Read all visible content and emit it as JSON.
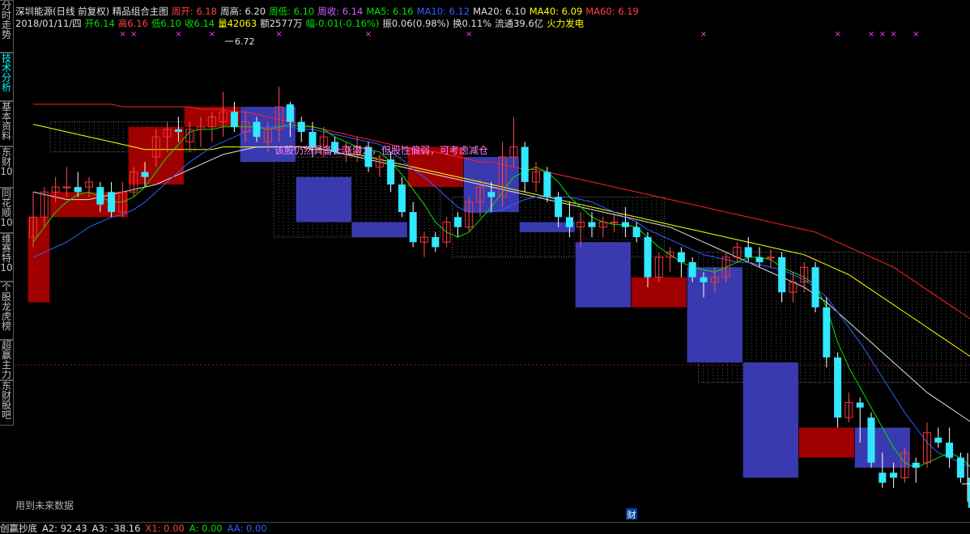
{
  "header": {
    "line1": [
      {
        "text": "深圳能源(日线 前复权) 精品组合主图",
        "color": "#e0e0e0"
      },
      {
        "text": "周开: 6.18",
        "color": "#ff4040"
      },
      {
        "text": "周高: 6.20",
        "color": "#e0e0e0"
      },
      {
        "text": "周低: 6.10",
        "color": "#00e000"
      },
      {
        "text": "周收: 6.14",
        "color": "#d060ff"
      },
      {
        "text": "MA5: 6.16",
        "color": "#00e000"
      },
      {
        "text": "MA10: 6.12",
        "color": "#3060ff"
      },
      {
        "text": "MA20: 6.10",
        "color": "#e0e0e0"
      },
      {
        "text": "MA40: 6.09",
        "color": "#ffff00"
      },
      {
        "text": "MA60: 6.19",
        "color": "#ff4040"
      }
    ],
    "line2": [
      {
        "text": "2018/01/11/四",
        "color": "#e0e0e0"
      },
      {
        "text": "开6.14",
        "color": "#00e000"
      },
      {
        "text": "高6.16",
        "color": "#ff4040"
      },
      {
        "text": "低6.10",
        "color": "#00e000"
      },
      {
        "text": "收6.14",
        "color": "#00e000"
      },
      {
        "text": "量42063",
        "color": "#ffff00"
      },
      {
        "text": "额2577万",
        "color": "#e0e0e0"
      },
      {
        "text": "幅-0.01(-0.16%)",
        "color": "#00e000"
      },
      {
        "text": "振0.06(0.98%)",
        "color": "#e0e0e0"
      },
      {
        "text": "换0.11%",
        "color": "#e0e0e0"
      },
      {
        "text": "流通39.6亿",
        "color": "#e0e0e0"
      },
      {
        "text": "火力发电",
        "color": "#ffff00"
      }
    ]
  },
  "sidebar": {
    "tabs": [
      {
        "label": "分时走势",
        "active": false
      },
      {
        "label": "技术分析",
        "active": true
      },
      {
        "label": "基本资料",
        "active": false
      },
      {
        "label": "东财10",
        "active": false
      },
      {
        "label": "同花顺10",
        "active": false
      },
      {
        "label": "维赛特10",
        "active": false
      },
      {
        "label": "个股龙虎榜",
        "active": false
      },
      {
        "label": "超赢主力",
        "active": false
      },
      {
        "label": "东财股吧",
        "active": false
      }
    ]
  },
  "annotations": {
    "high_label": "6.72",
    "note": "该股仍然具备上涨潜力，但股性偏弱，可考虑减仓",
    "future_data": "用到未来数据",
    "finance_marker": "财"
  },
  "footer": {
    "items": [
      {
        "text": "创赢抄底",
        "color": "#e0e0e0"
      },
      {
        "text": "A2: 92.43",
        "color": "#e0e0e0"
      },
      {
        "text": "A3: -38.16",
        "color": "#e0e0e0"
      },
      {
        "text": "X1: 0.00",
        "color": "#ff4040"
      },
      {
        "text": "A: 0.00",
        "color": "#00e000"
      },
      {
        "text": "AA: 0.00",
        "color": "#3060ff"
      }
    ]
  },
  "chart_data": {
    "type": "candlestick",
    "title": "深圳能源(日线 前复权) 精品组合主图",
    "colors": {
      "up": "#ff3030",
      "down": "#30e8ff",
      "ma5": "#00e000",
      "ma10": "#3060ff",
      "ma20": "#e0e0e0",
      "ma40": "#ffff00",
      "ma60": "#ff2020",
      "box_up": "#a00000",
      "box_down": "#3a3ab0"
    },
    "ylim": [
      5.0,
      6.95
    ],
    "candles": [
      {
        "o": 6.12,
        "h": 6.3,
        "l": 6.08,
        "c": 6.2
      },
      {
        "o": 6.2,
        "h": 6.32,
        "l": 6.16,
        "c": 6.3
      },
      {
        "o": 6.3,
        "h": 6.36,
        "l": 6.26,
        "c": 6.32
      },
      {
        "o": 6.32,
        "h": 6.4,
        "l": 6.28,
        "c": 6.32
      },
      {
        "o": 6.32,
        "h": 6.38,
        "l": 6.28,
        "c": 6.3
      },
      {
        "o": 6.32,
        "h": 6.36,
        "l": 6.28,
        "c": 6.34
      },
      {
        "o": 6.32,
        "h": 6.34,
        "l": 6.22,
        "c": 6.25
      },
      {
        "o": 6.3,
        "h": 6.34,
        "l": 6.2,
        "c": 6.22
      },
      {
        "o": 6.22,
        "h": 6.34,
        "l": 6.2,
        "c": 6.3
      },
      {
        "o": 6.3,
        "h": 6.4,
        "l": 6.28,
        "c": 6.38
      },
      {
        "o": 6.38,
        "h": 6.42,
        "l": 6.32,
        "c": 6.36
      },
      {
        "o": 6.44,
        "h": 6.55,
        "l": 6.4,
        "c": 6.52
      },
      {
        "o": 6.52,
        "h": 6.58,
        "l": 6.46,
        "c": 6.55
      },
      {
        "o": 6.55,
        "h": 6.6,
        "l": 6.5,
        "c": 6.54
      },
      {
        "o": 6.5,
        "h": 6.58,
        "l": 6.46,
        "c": 6.55
      },
      {
        "o": 6.55,
        "h": 6.6,
        "l": 6.48,
        "c": 6.56
      },
      {
        "o": 6.56,
        "h": 6.62,
        "l": 6.5,
        "c": 6.6
      },
      {
        "o": 6.58,
        "h": 6.7,
        "l": 6.52,
        "c": 6.62
      },
      {
        "o": 6.62,
        "h": 6.66,
        "l": 6.54,
        "c": 6.56
      },
      {
        "o": 6.54,
        "h": 6.62,
        "l": 6.5,
        "c": 6.58
      },
      {
        "o": 6.58,
        "h": 6.6,
        "l": 6.5,
        "c": 6.52
      },
      {
        "o": 6.5,
        "h": 6.58,
        "l": 6.46,
        "c": 6.55
      },
      {
        "o": 6.55,
        "h": 6.72,
        "l": 6.5,
        "c": 6.64
      },
      {
        "o": 6.65,
        "h": 6.66,
        "l": 6.52,
        "c": 6.58
      },
      {
        "o": 6.58,
        "h": 6.6,
        "l": 6.5,
        "c": 6.54
      },
      {
        "o": 6.54,
        "h": 6.58,
        "l": 6.44,
        "c": 6.48
      },
      {
        "o": 6.48,
        "h": 6.56,
        "l": 6.44,
        "c": 6.52
      },
      {
        "o": 6.5,
        "h": 6.52,
        "l": 6.45,
        "c": 6.46
      },
      {
        "o": 6.46,
        "h": 6.5,
        "l": 6.42,
        "c": 6.48
      },
      {
        "o": 6.46,
        "h": 6.52,
        "l": 6.42,
        "c": 6.48
      },
      {
        "o": 6.48,
        "h": 6.5,
        "l": 6.38,
        "c": 6.4
      },
      {
        "o": 6.4,
        "h": 6.45,
        "l": 6.36,
        "c": 6.43
      },
      {
        "o": 6.43,
        "h": 6.46,
        "l": 6.3,
        "c": 6.33
      },
      {
        "o": 6.33,
        "h": 6.36,
        "l": 6.2,
        "c": 6.22
      },
      {
        "o": 6.22,
        "h": 6.26,
        "l": 6.08,
        "c": 6.1
      },
      {
        "o": 6.1,
        "h": 6.14,
        "l": 6.04,
        "c": 6.12
      },
      {
        "o": 6.12,
        "h": 6.14,
        "l": 6.06,
        "c": 6.08
      },
      {
        "o": 6.1,
        "h": 6.2,
        "l": 6.08,
        "c": 6.18
      },
      {
        "o": 6.2,
        "h": 6.22,
        "l": 6.12,
        "c": 6.16
      },
      {
        "o": 6.16,
        "h": 6.28,
        "l": 6.14,
        "c": 6.26
      },
      {
        "o": 6.26,
        "h": 6.35,
        "l": 6.2,
        "c": 6.32
      },
      {
        "o": 6.3,
        "h": 6.34,
        "l": 6.22,
        "c": 6.28
      },
      {
        "o": 6.28,
        "h": 6.5,
        "l": 6.24,
        "c": 6.44
      },
      {
        "o": 6.44,
        "h": 6.6,
        "l": 6.4,
        "c": 6.48
      },
      {
        "o": 6.48,
        "h": 6.5,
        "l": 6.3,
        "c": 6.34
      },
      {
        "o": 6.34,
        "h": 6.42,
        "l": 6.3,
        "c": 6.38
      },
      {
        "o": 6.38,
        "h": 6.4,
        "l": 6.26,
        "c": 6.28
      },
      {
        "o": 6.28,
        "h": 6.3,
        "l": 6.16,
        "c": 6.2
      },
      {
        "o": 6.2,
        "h": 6.26,
        "l": 6.12,
        "c": 6.16
      },
      {
        "o": 6.16,
        "h": 6.22,
        "l": 6.08,
        "c": 6.18
      },
      {
        "o": 6.18,
        "h": 6.22,
        "l": 6.12,
        "c": 6.16
      },
      {
        "o": 6.16,
        "h": 6.2,
        "l": 6.12,
        "c": 6.18
      },
      {
        "o": 6.18,
        "h": 6.22,
        "l": 6.14,
        "c": 6.18
      },
      {
        "o": 6.18,
        "h": 6.24,
        "l": 6.12,
        "c": 6.16
      },
      {
        "o": 6.16,
        "h": 6.18,
        "l": 6.1,
        "c": 6.12
      },
      {
        "o": 6.12,
        "h": 6.14,
        "l": 5.92,
        "c": 5.96
      },
      {
        "o": 5.96,
        "h": 6.06,
        "l": 5.94,
        "c": 6.04
      },
      {
        "o": 6.04,
        "h": 6.08,
        "l": 5.98,
        "c": 6.06
      },
      {
        "o": 6.06,
        "h": 6.08,
        "l": 5.96,
        "c": 6.02
      },
      {
        "o": 6.02,
        "h": 6.04,
        "l": 5.94,
        "c": 5.96
      },
      {
        "o": 5.96,
        "h": 5.98,
        "l": 5.88,
        "c": 5.94
      },
      {
        "o": 5.94,
        "h": 6.0,
        "l": 5.9,
        "c": 5.96
      },
      {
        "o": 5.96,
        "h": 6.06,
        "l": 5.94,
        "c": 6.04
      },
      {
        "o": 6.04,
        "h": 6.1,
        "l": 6.02,
        "c": 6.08
      },
      {
        "o": 6.08,
        "h": 6.12,
        "l": 6.02,
        "c": 6.04
      },
      {
        "o": 6.04,
        "h": 6.08,
        "l": 6.0,
        "c": 6.02
      },
      {
        "o": 6.04,
        "h": 6.07,
        "l": 6.0,
        "c": 6.04
      },
      {
        "o": 6.04,
        "h": 6.06,
        "l": 5.86,
        "c": 5.9
      },
      {
        "o": 5.9,
        "h": 5.98,
        "l": 5.86,
        "c": 5.94
      },
      {
        "o": 5.94,
        "h": 6.02,
        "l": 5.9,
        "c": 6.0
      },
      {
        "o": 6.0,
        "h": 6.02,
        "l": 5.82,
        "c": 5.84
      },
      {
        "o": 5.84,
        "h": 5.88,
        "l": 5.6,
        "c": 5.64
      },
      {
        "o": 5.64,
        "h": 5.66,
        "l": 5.36,
        "c": 5.4
      },
      {
        "o": 5.4,
        "h": 5.5,
        "l": 5.38,
        "c": 5.46
      },
      {
        "o": 5.46,
        "h": 5.48,
        "l": 5.3,
        "c": 5.44
      },
      {
        "o": 5.4,
        "h": 5.42,
        "l": 5.2,
        "c": 5.22
      },
      {
        "o": 5.18,
        "h": 5.26,
        "l": 5.12,
        "c": 5.14
      },
      {
        "o": 5.18,
        "h": 5.22,
        "l": 5.12,
        "c": 5.16
      },
      {
        "o": 5.16,
        "h": 5.28,
        "l": 5.14,
        "c": 5.26
      },
      {
        "o": 5.22,
        "h": 5.24,
        "l": 5.14,
        "c": 5.2
      },
      {
        "o": 5.22,
        "h": 5.38,
        "l": 5.2,
        "c": 5.34
      },
      {
        "o": 5.32,
        "h": 5.36,
        "l": 5.28,
        "c": 5.3
      },
      {
        "o": 5.3,
        "h": 5.36,
        "l": 5.2,
        "c": 5.24
      },
      {
        "o": 5.24,
        "h": 5.26,
        "l": 5.14,
        "c": 5.16
      },
      {
        "o": 5.16,
        "h": 5.18,
        "l": 5.02,
        "c": 5.04
      },
      {
        "o": 5.06,
        "h": 5.18,
        "l": 4.98,
        "c": 5.04
      }
    ],
    "ma": {
      "ma5": [
        6.1,
        6.16,
        6.22,
        6.26,
        6.29,
        6.3,
        6.28,
        6.26,
        6.26,
        6.28,
        6.32,
        6.38,
        6.44,
        6.49,
        6.54,
        6.55,
        6.55,
        6.56,
        6.56,
        6.56,
        6.56,
        6.55,
        6.56,
        6.57,
        6.56,
        6.56,
        6.55,
        6.52,
        6.5,
        6.48,
        6.47,
        6.46,
        6.42,
        6.37,
        6.31,
        6.25,
        6.18,
        6.14,
        6.12,
        6.14,
        6.19,
        6.24,
        6.3,
        6.36,
        6.38,
        6.4,
        6.38,
        6.34,
        6.28,
        6.24,
        6.2,
        6.18,
        6.17,
        6.17,
        6.16,
        6.12,
        6.08,
        6.05,
        6.02,
        6.0,
        5.99,
        5.98,
        6.0,
        6.02,
        6.04,
        6.04,
        6.03,
        6.0,
        5.98,
        5.96,
        5.93,
        5.84,
        5.7,
        5.6,
        5.52,
        5.44,
        5.36,
        5.28,
        5.22,
        5.2,
        5.22,
        5.24,
        5.26,
        5.24,
        5.2,
        5.16
      ],
      "ma10": [
        6.04,
        6.06,
        6.08,
        6.1,
        6.13,
        6.16,
        6.18,
        6.2,
        6.21,
        6.23,
        6.26,
        6.3,
        6.34,
        6.38,
        6.42,
        6.45,
        6.48,
        6.5,
        6.52,
        6.54,
        6.55,
        6.56,
        6.56,
        6.56,
        6.55,
        6.55,
        6.54,
        6.53,
        6.52,
        6.51,
        6.5,
        6.49,
        6.46,
        6.43,
        6.39,
        6.36,
        6.32,
        6.28,
        6.24,
        6.22,
        6.22,
        6.22,
        6.23,
        6.25,
        6.27,
        6.28,
        6.28,
        6.28,
        6.28,
        6.27,
        6.26,
        6.24,
        6.22,
        6.2,
        6.18,
        6.15,
        6.13,
        6.11,
        6.09,
        6.07,
        6.05,
        6.04,
        6.03,
        6.02,
        6.02,
        6.01,
        6.0,
        5.99,
        5.97,
        5.95,
        5.92,
        5.88,
        5.82,
        5.76,
        5.7,
        5.63,
        5.56,
        5.49,
        5.42,
        5.36,
        5.3,
        5.26,
        5.24,
        5.22,
        5.2,
        5.18
      ],
      "ma20": [
        6.3,
        6.29,
        6.28,
        6.27,
        6.27,
        6.27,
        6.28,
        6.29,
        6.3,
        6.31,
        6.32,
        6.33,
        6.35,
        6.37,
        6.39,
        6.41,
        6.43,
        6.45,
        6.46,
        6.47,
        6.48,
        6.48,
        6.48,
        6.48,
        6.48,
        6.48,
        6.47,
        6.46,
        6.45,
        6.44,
        6.43,
        6.42,
        6.41,
        6.4,
        6.39,
        6.38,
        6.37,
        6.36,
        6.35,
        6.34,
        6.33,
        6.32,
        6.31,
        6.3,
        6.29,
        6.28,
        6.27,
        6.26,
        6.25,
        6.24,
        6.23,
        6.22,
        6.21,
        6.2,
        6.19,
        6.18,
        6.17,
        6.16,
        6.14,
        6.12,
        6.1,
        6.08,
        6.06,
        6.04,
        6.02,
        6.0,
        5.98,
        5.96,
        5.94,
        5.92,
        5.89,
        5.86,
        5.82,
        5.78,
        5.74,
        5.7,
        5.66,
        5.62,
        5.58,
        5.54,
        5.5,
        5.47,
        5.44,
        5.41,
        5.38,
        5.35
      ],
      "ma40": [
        6.57,
        6.56,
        6.55,
        6.54,
        6.53,
        6.52,
        6.51,
        6.5,
        6.49,
        6.48,
        6.47,
        6.47,
        6.47,
        6.47,
        6.47,
        6.47,
        6.47,
        6.48,
        6.48,
        6.48,
        6.48,
        6.48,
        6.48,
        6.48,
        6.48,
        6.47,
        6.47,
        6.46,
        6.45,
        6.45,
        6.44,
        6.43,
        6.42,
        6.41,
        6.4,
        6.39,
        6.38,
        6.37,
        6.36,
        6.35,
        6.34,
        6.33,
        6.32,
        6.31,
        6.3,
        6.29,
        6.28,
        6.27,
        6.26,
        6.25,
        6.24,
        6.23,
        6.22,
        6.21,
        6.2,
        6.19,
        6.18,
        6.17,
        6.16,
        6.15,
        6.14,
        6.13,
        6.12,
        6.11,
        6.1,
        6.09,
        6.08,
        6.07,
        6.06,
        6.05,
        6.03,
        6.01,
        5.99,
        5.97,
        5.94,
        5.91,
        5.88,
        5.85,
        5.82,
        5.79,
        5.76,
        5.73,
        5.7,
        5.67,
        5.64,
        5.61
      ],
      "ma60": [
        6.65,
        6.65,
        6.65,
        6.65,
        6.65,
        6.65,
        6.65,
        6.65,
        6.64,
        6.64,
        6.64,
        6.64,
        6.64,
        6.64,
        6.64,
        6.63,
        6.63,
        6.63,
        6.62,
        6.62,
        6.61,
        6.6,
        6.59,
        6.58,
        6.57,
        6.56,
        6.55,
        6.54,
        6.53,
        6.52,
        6.51,
        6.5,
        6.49,
        6.48,
        6.47,
        6.46,
        6.46,
        6.45,
        6.44,
        6.43,
        6.42,
        6.42,
        6.41,
        6.4,
        6.39,
        6.39,
        6.38,
        6.37,
        6.36,
        6.35,
        6.34,
        6.33,
        6.32,
        6.31,
        6.3,
        6.29,
        6.28,
        6.27,
        6.26,
        6.25,
        6.24,
        6.23,
        6.22,
        6.21,
        6.2,
        6.19,
        6.18,
        6.17,
        6.16,
        6.15,
        6.14,
        6.12,
        6.1,
        6.08,
        6.06,
        6.04,
        6.02,
        6.0,
        5.97,
        5.94,
        5.91,
        5.88,
        5.85,
        5.82,
        5.79,
        5.76
      ]
    },
    "weekly_boxes": [
      {
        "start": 0,
        "end": 1,
        "o": 5.86,
        "c": 6.2,
        "dir": "up"
      },
      {
        "start": 2,
        "end": 8,
        "o": 6.2,
        "c": 6.3,
        "dir": "up"
      },
      {
        "start": 9,
        "end": 13,
        "o": 6.33,
        "c": 6.56,
        "dir": "up"
      },
      {
        "start": 14,
        "end": 18,
        "o": 6.56,
        "c": 6.64,
        "dir": "up"
      },
      {
        "start": 19,
        "end": 23,
        "o": 6.64,
        "c": 6.42,
        "dir": "down"
      },
      {
        "start": 24,
        "end": 28,
        "o": 6.36,
        "c": 6.18,
        "dir": "down"
      },
      {
        "start": 29,
        "end": 33,
        "o": 6.18,
        "c": 6.12,
        "dir": "down"
      },
      {
        "start": 34,
        "end": 38,
        "o": 6.32,
        "c": 6.48,
        "dir": "up"
      },
      {
        "start": 39,
        "end": 43,
        "o": 6.44,
        "c": 6.22,
        "dir": "down"
      },
      {
        "start": 44,
        "end": 48,
        "o": 6.18,
        "c": 6.14,
        "dir": "down"
      },
      {
        "start": 49,
        "end": 53,
        "o": 6.1,
        "c": 5.84,
        "dir": "down"
      },
      {
        "start": 54,
        "end": 58,
        "o": 5.84,
        "c": 5.96,
        "dir": "up"
      },
      {
        "start": 59,
        "end": 63,
        "o": 6.0,
        "c": 5.62,
        "dir": "down"
      },
      {
        "start": 64,
        "end": 68,
        "o": 5.62,
        "c": 5.16,
        "dir": "down"
      },
      {
        "start": 69,
        "end": 73,
        "o": 5.36,
        "c": 5.24,
        "dir": "up"
      },
      {
        "start": 74,
        "end": 78,
        "o": 5.36,
        "c": 5.2,
        "dir": "down"
      }
    ],
    "dotted_boxes": [
      {
        "start": 2,
        "end": 14,
        "top": 6.58,
        "bottom": 6.46
      },
      {
        "start": 22,
        "end": 36,
        "top": 6.44,
        "bottom": 6.12
      },
      {
        "start": 38,
        "end": 56,
        "top": 6.28,
        "bottom": 6.04
      },
      {
        "start": 60,
        "end": 86,
        "top": 6.06,
        "bottom": 5.54
      }
    ],
    "magenta_markers": [
      8,
      9,
      13,
      16,
      22,
      30,
      39,
      60,
      72,
      75,
      76,
      77,
      79
    ]
  }
}
